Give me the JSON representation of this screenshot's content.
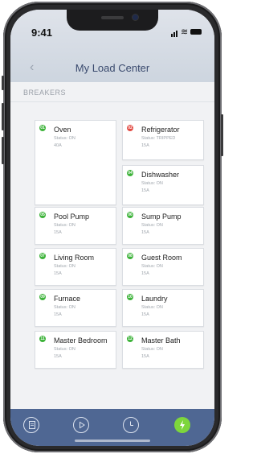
{
  "status_bar": {
    "time": "9:41"
  },
  "header": {
    "title": "My Load Center"
  },
  "section": {
    "label": "BREAKERS"
  },
  "breakers": [
    {
      "number": "01",
      "name": "Oven",
      "status": "Status: ON",
      "amperage": "40A",
      "state": "on"
    },
    {
      "number": "02",
      "name": "Refrigerator",
      "status": "Status: TRIPPED",
      "amperage": "15A",
      "state": "tripped"
    },
    {
      "number": "04",
      "name": "Dishwasher",
      "status": "Status: ON",
      "amperage": "15A",
      "state": "on"
    },
    {
      "number": "05",
      "name": "Pool Pump",
      "status": "Status: ON",
      "amperage": "15A",
      "state": "on"
    },
    {
      "number": "06",
      "name": "Sump Pump",
      "status": "Status: ON",
      "amperage": "15A",
      "state": "on"
    },
    {
      "number": "07",
      "name": "Living Room",
      "status": "Status: ON",
      "amperage": "15A",
      "state": "on"
    },
    {
      "number": "08",
      "name": "Guest Room",
      "status": "Status: ON",
      "amperage": "15A",
      "state": "on"
    },
    {
      "number": "09",
      "name": "Furnace",
      "status": "Status: ON",
      "amperage": "15A",
      "state": "on"
    },
    {
      "number": "10",
      "name": "Laundry",
      "status": "Status: ON",
      "amperage": "15A",
      "state": "on"
    },
    {
      "number": "11",
      "name": "Master Bedroom",
      "status": "Status: ON",
      "amperage": "15A",
      "state": "on"
    },
    {
      "number": "12",
      "name": "Master Bath",
      "status": "Status: ON",
      "amperage": "15A",
      "state": "on"
    }
  ],
  "bottom_nav": {
    "items": [
      {
        "icon": "document-icon",
        "active": false
      },
      {
        "icon": "play-icon",
        "active": false
      },
      {
        "icon": "clock-icon",
        "active": false
      },
      {
        "icon": "lightning-icon",
        "active": true
      }
    ]
  },
  "colors": {
    "on": "#3db33a",
    "tripped": "#e24a42",
    "nav_bar": "#4f6793",
    "active_tab": "#7dd63c",
    "title": "#3a4a6e"
  }
}
